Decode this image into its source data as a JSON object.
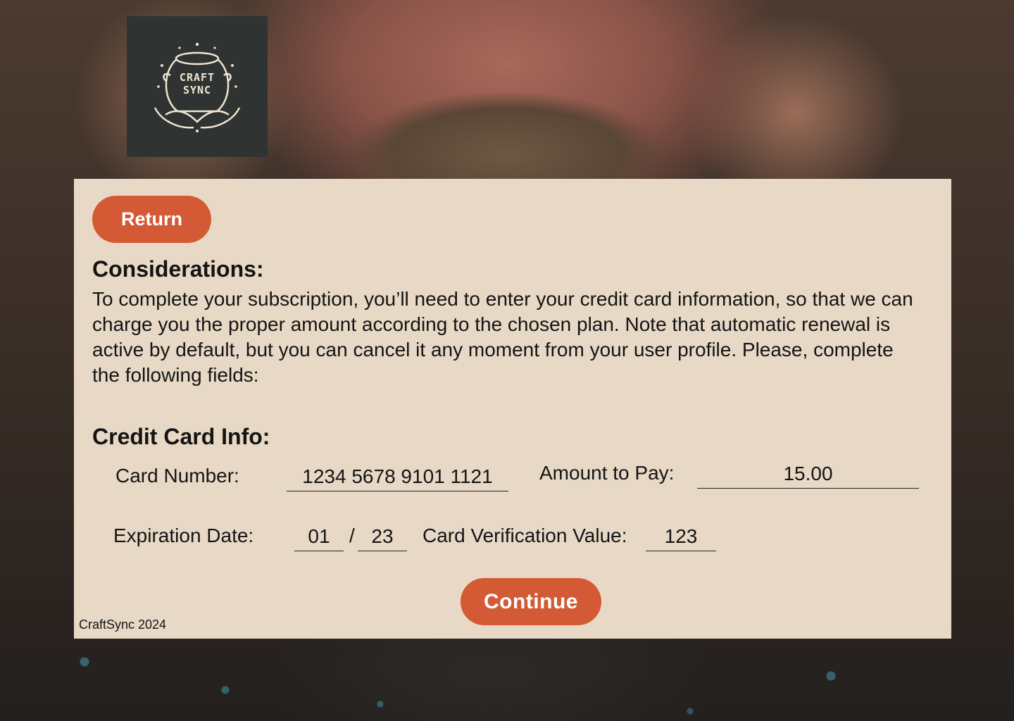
{
  "brand": {
    "logo_line1": "CRAFT",
    "logo_line2": "SYNC"
  },
  "nav": {
    "return_label": "Return"
  },
  "considerations": {
    "heading": "Considerations:",
    "text": "To complete your subscription, you’ll need to enter your credit card information, so that we can charge you the proper amount according to the chosen plan. Note that automatic renewal is active by default, but you can cancel it any moment from your user profile. Please, complete the following fields:"
  },
  "card": {
    "heading": "Credit Card Info:",
    "number_label": "Card Number:",
    "number_value": "1234 5678 9101 1121",
    "amount_label": "Amount to Pay:",
    "amount_value": "15.00",
    "expiry_label": "Expiration Date:",
    "expiry_month": "01",
    "expiry_separator": "/",
    "expiry_year": "23",
    "cvv_label": "Card Verification Value:",
    "cvv_value": "123"
  },
  "actions": {
    "continue_label": "Continue"
  },
  "footer": {
    "copyright": "CraftSync 2024"
  },
  "colors": {
    "accent": "#d45a35",
    "panel": "#e8d9c6",
    "logo_bg": "#2f3331"
  }
}
